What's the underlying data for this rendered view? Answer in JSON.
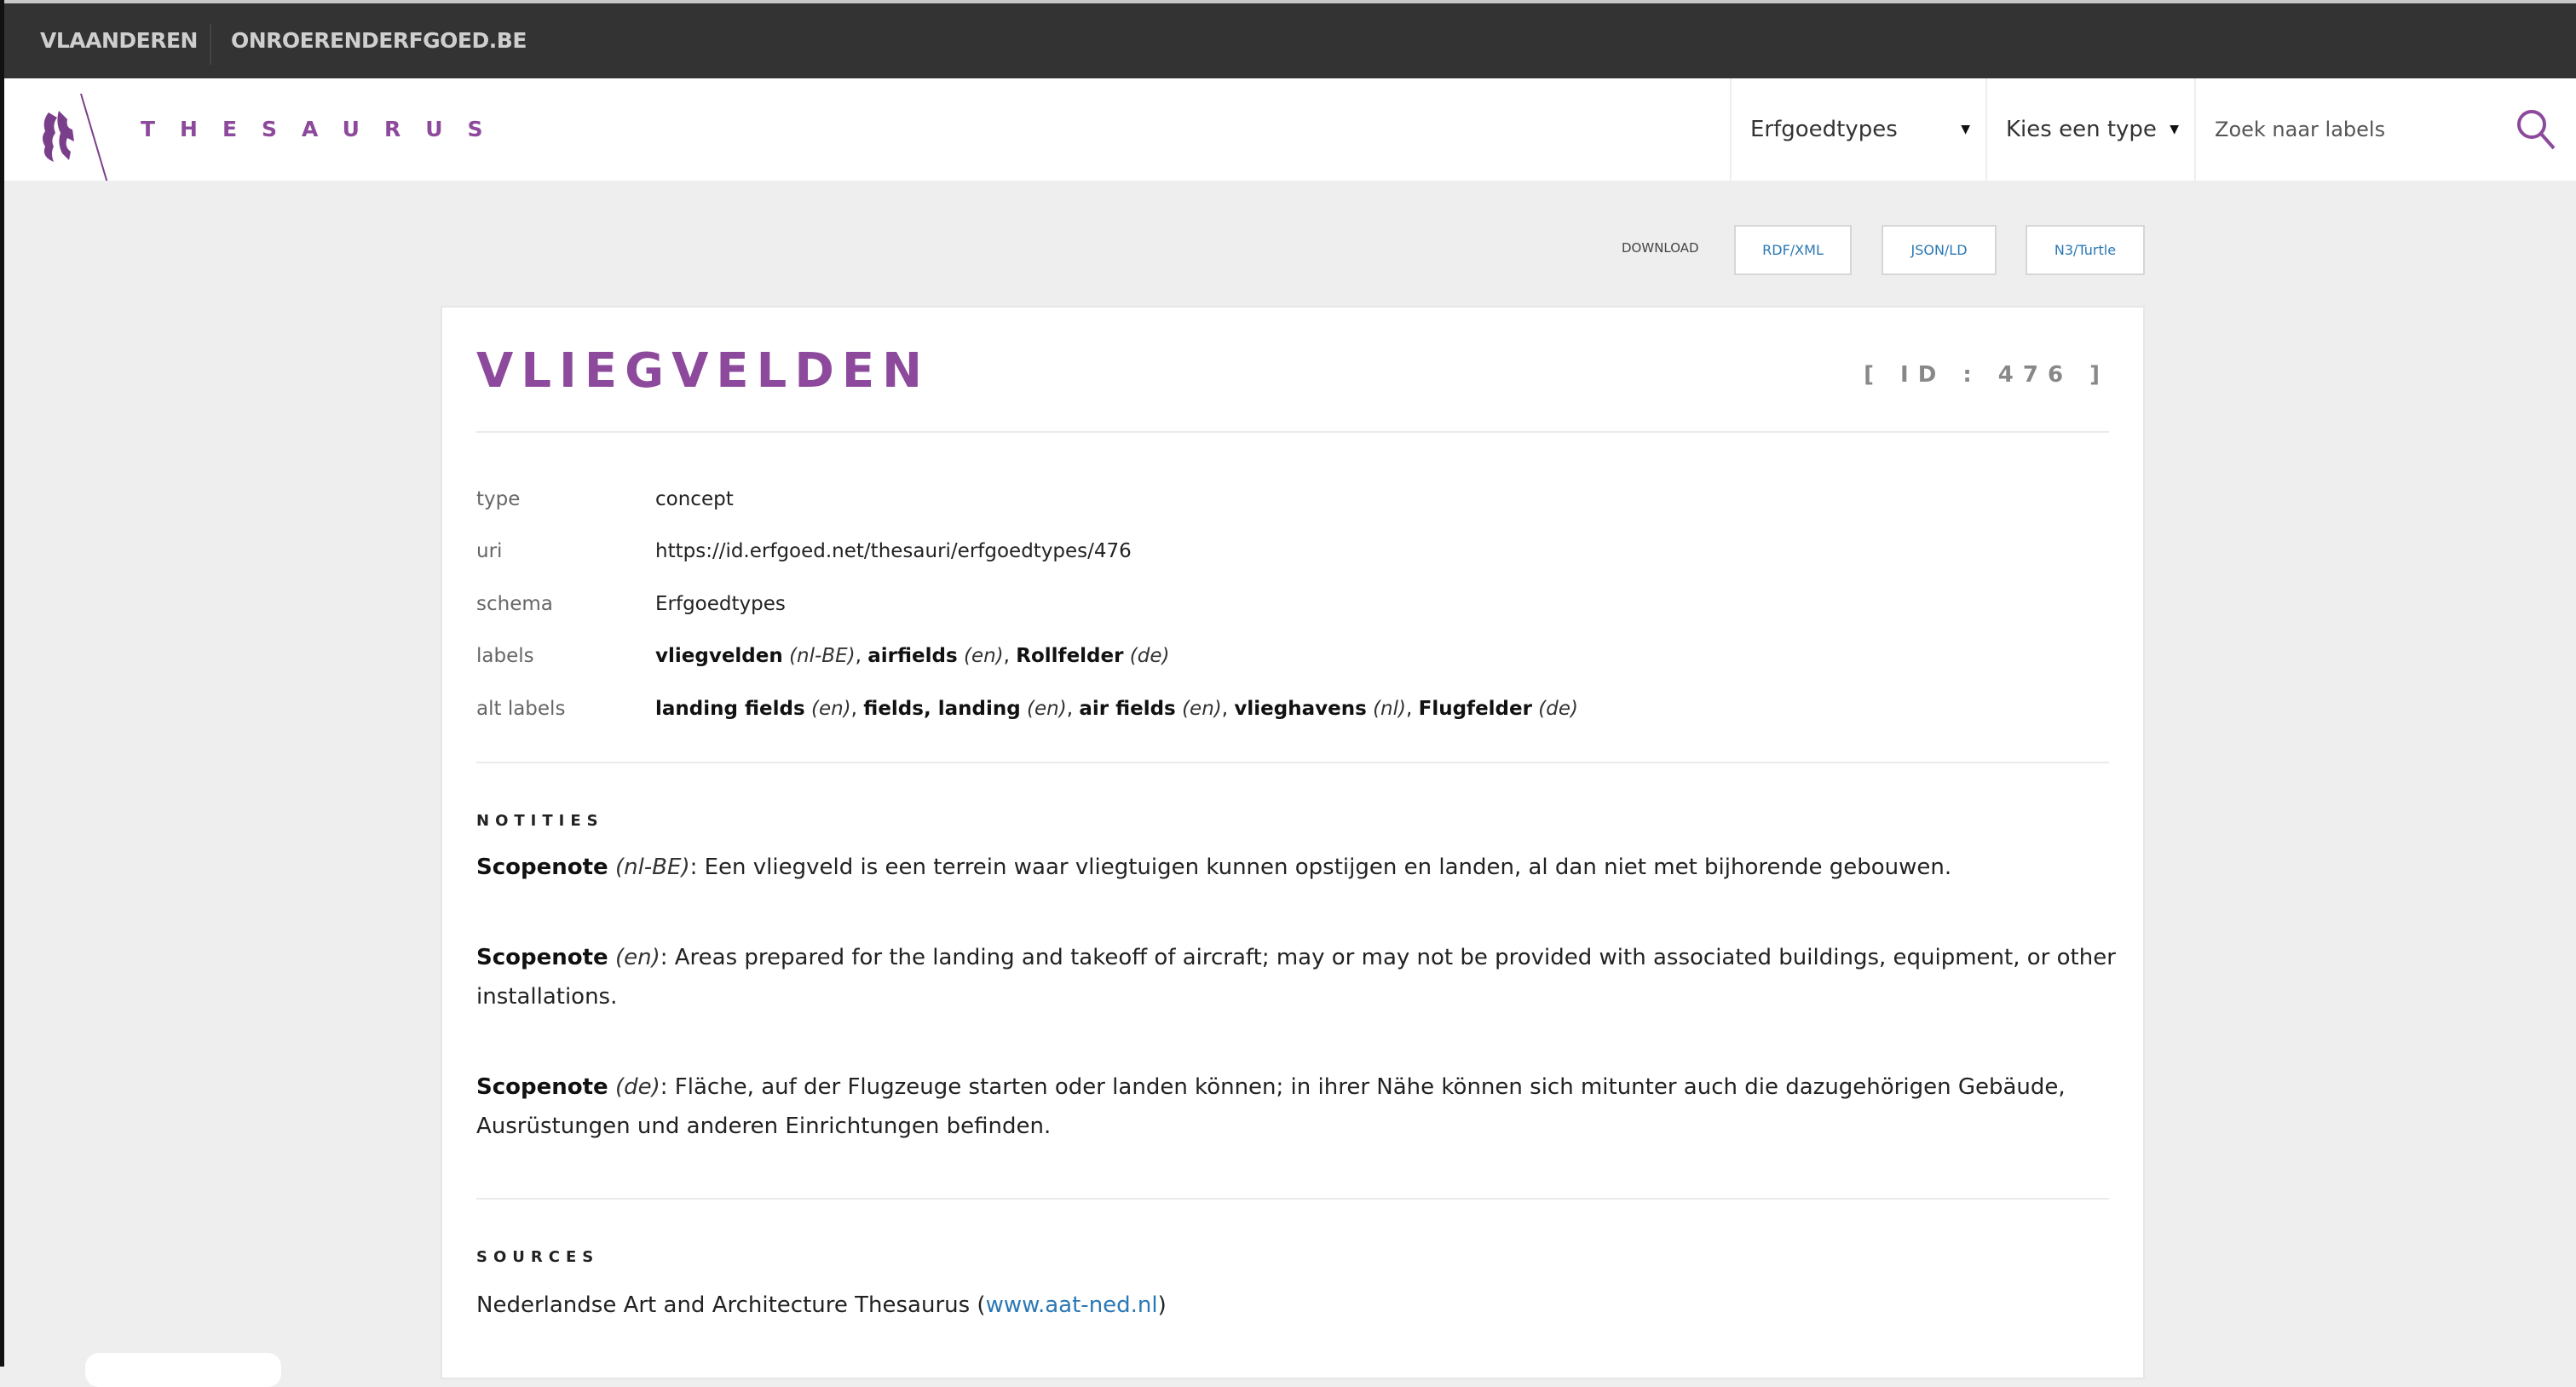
{
  "topbar": {
    "links": [
      "VLAANDEREN",
      "ONROERENDERFGOED.BE"
    ]
  },
  "header": {
    "brand": "THESAURUS",
    "dropdown_scheme": "Erfgoedtypes",
    "dropdown_type": "Kies een type",
    "search_placeholder": "Zoek naar labels"
  },
  "download": {
    "label": "DOWNLOAD",
    "buttons": [
      "RDF/XML",
      "JSON/LD",
      "N3/Turtle"
    ]
  },
  "concept": {
    "title": "VLIEGVELDEN",
    "id": "[ ID : 476 ]",
    "fields": {
      "type": {
        "key": "type",
        "value": "concept"
      },
      "uri": {
        "key": "uri",
        "value": "https://id.erfgoed.net/thesauri/erfgoedtypes/476"
      },
      "schema": {
        "key": "schema",
        "value": "Erfgoedtypes"
      },
      "labels": {
        "key": "labels",
        "items": [
          {
            "label": "vliegvelden",
            "lang": "(nl-BE)"
          },
          {
            "label": "airfields",
            "lang": "(en)"
          },
          {
            "label": "Rollfelder",
            "lang": "(de)"
          }
        ]
      },
      "alt_labels": {
        "key": "alt labels",
        "items": [
          {
            "label": "landing fields",
            "lang": "(en)"
          },
          {
            "label": "fields, landing",
            "lang": "(en)"
          },
          {
            "label": "air fields",
            "lang": "(en)"
          },
          {
            "label": "vlieghavens",
            "lang": "(nl)"
          },
          {
            "label": "Flugfelder",
            "lang": "(de)"
          }
        ]
      }
    },
    "notes_heading": "NOTITIES",
    "notes": [
      {
        "type": "Scopenote",
        "lang": "(nl-BE)",
        "text": "Een vliegveld is een terrein waar vliegtuigen kunnen opstijgen en landen, al dan niet met bijhorende gebouwen."
      },
      {
        "type": "Scopenote",
        "lang": "(en)",
        "text": "Areas prepared for the landing and takeoff of aircraft; may or may not be provided with associated buildings, equipment, or other installations."
      },
      {
        "type": "Scopenote",
        "lang": "(de)",
        "text": "Fläche, auf der Flugzeuge starten oder landen können; in ihrer Nähe können sich mitunter auch die dazugehörigen Gebäude, Ausrüstungen und anderen Einrichtungen befinden."
      }
    ],
    "sources_heading": "SOURCES",
    "source": {
      "text": "Nederlandse Art and Architecture Thesaurus (",
      "link": "www.aat-ned.nl",
      "close": ")"
    }
  },
  "colors": {
    "brand": "#8d4a9c",
    "link": "#2a78b5",
    "topbar": "#333333",
    "background": "#eeeeee"
  }
}
